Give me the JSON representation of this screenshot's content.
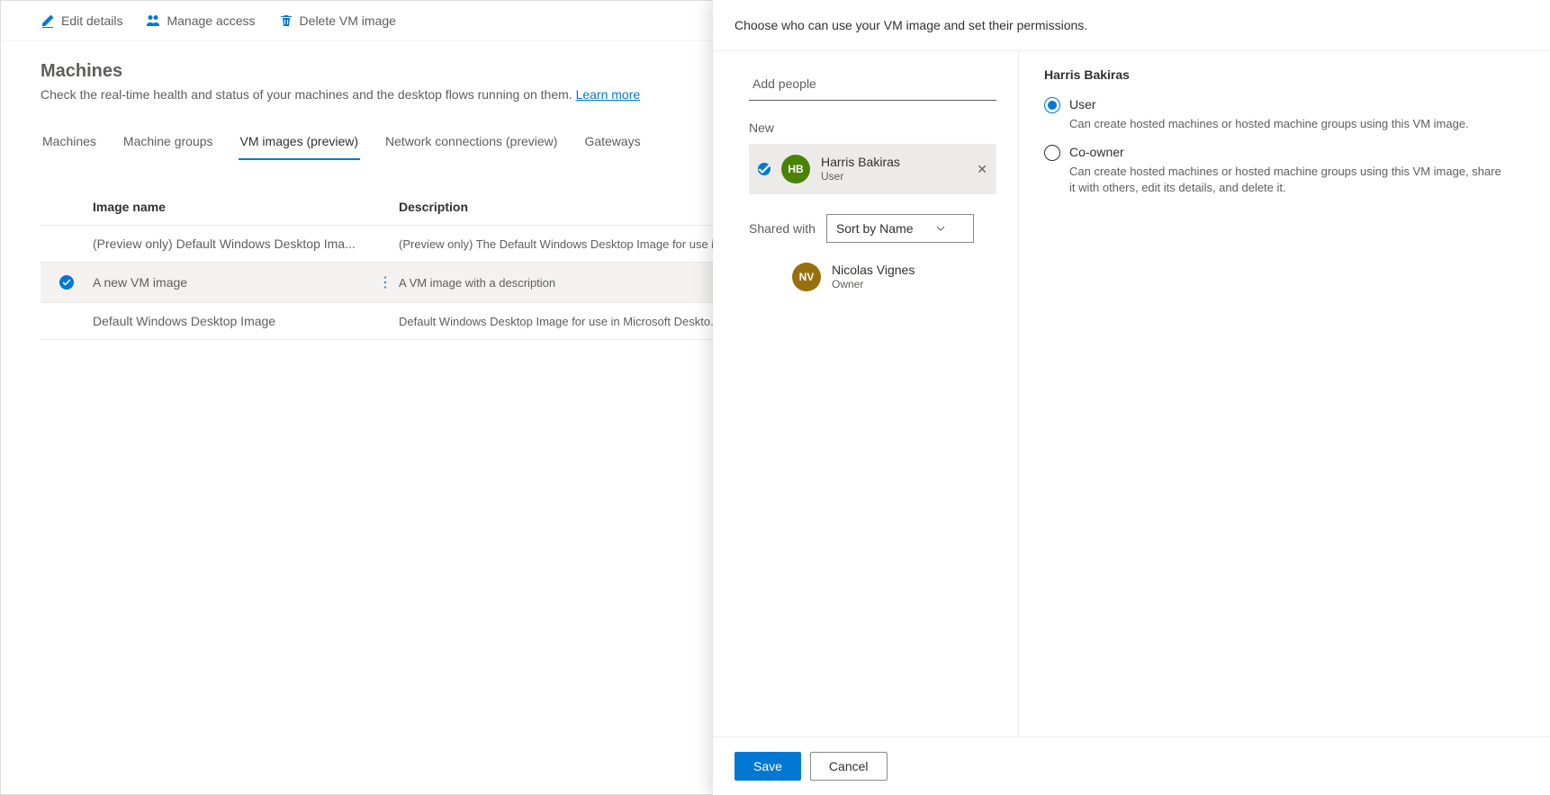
{
  "toolbar": {
    "edit_details": "Edit details",
    "manage_access": "Manage access",
    "delete_vm_image": "Delete VM image"
  },
  "page": {
    "title": "Machines",
    "subtitle_prefix": "Check the real-time health and status of your machines and the desktop flows running on them. ",
    "learn_more": "Learn more"
  },
  "tabs": [
    {
      "label": "Machines"
    },
    {
      "label": "Machine groups"
    },
    {
      "label": "VM images (preview)",
      "active": true
    },
    {
      "label": "Network connections (preview)"
    },
    {
      "label": "Gateways"
    }
  ],
  "table": {
    "headers": {
      "name": "Image name",
      "description": "Description"
    },
    "rows": [
      {
        "name": "(Preview only) Default Windows Desktop Ima...",
        "description": "(Preview only) The Default Windows Desktop Image for use i...",
        "selected": false
      },
      {
        "name": "A new VM image",
        "description": "A VM image with a description",
        "selected": true
      },
      {
        "name": "Default Windows Desktop Image",
        "description": "Default Windows Desktop Image for use in Microsoft Deskto...",
        "selected": false
      }
    ]
  },
  "panel": {
    "header": "Choose who can use your VM image and set their permissions.",
    "add_people_placeholder": "Add people",
    "new_label": "New",
    "new_person": {
      "initials": "HB",
      "name": "Harris Bakiras",
      "role": "User"
    },
    "shared_with_label": "Shared with",
    "sort_by": "Sort by Name",
    "shared_person": {
      "initials": "NV",
      "name": "Nicolas Vignes",
      "role": "Owner"
    },
    "selected_user_name": "Harris Bakiras",
    "permissions": {
      "user": {
        "label": "User",
        "desc": "Can create hosted machines or hosted machine groups using this VM image."
      },
      "coowner": {
        "label": "Co-owner",
        "desc": "Can create hosted machines or hosted machine groups using this VM image, share it with others, edit its details, and delete it."
      }
    },
    "save": "Save",
    "cancel": "Cancel"
  }
}
